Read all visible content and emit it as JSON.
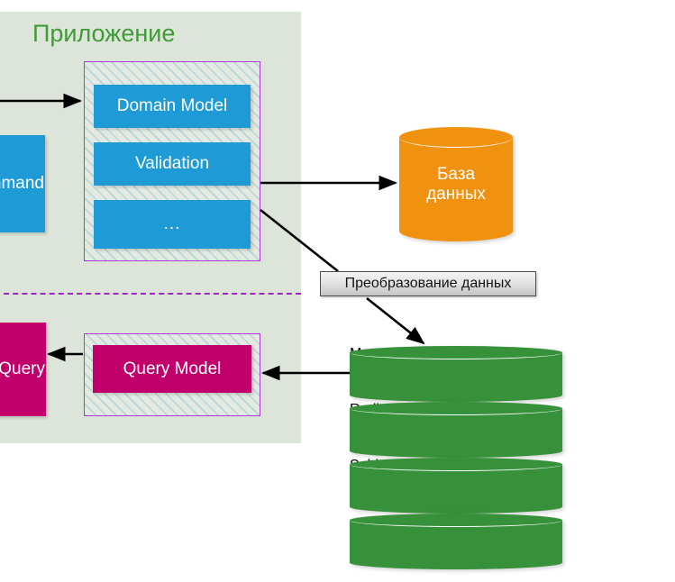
{
  "diagram": {
    "title": "Приложение",
    "title_color": "#3f9b35",
    "panel_color": "#dde5da"
  },
  "command_side": {
    "command_box_label": "Command",
    "container_items": [
      {
        "label": "Domain Model",
        "color": "#1e9bd7"
      },
      {
        "label": "Validation",
        "color": "#1e9bd7"
      },
      {
        "label": "...",
        "color": "#1e9bd7"
      }
    ]
  },
  "query_side": {
    "query_box_label": "Query",
    "query_model_label": "Query Model",
    "query_color": "#c2006c"
  },
  "write_store": {
    "label_line1": "База",
    "label_line2": "данных",
    "color": "#f0920f"
  },
  "read_stores": [
    {
      "label": "MongoDB",
      "color": "#36913a"
    },
    {
      "label": "Redis",
      "color": "#36913a"
    },
    {
      "label": "Sphinx",
      "color": "#36913a"
    },
    {
      "label": "...",
      "color": "#36913a"
    }
  ],
  "annotations": {
    "transform_label": "Преобразование данных"
  },
  "connectors": [
    {
      "name": "command-to-domain",
      "from": "command",
      "to": "domain-container"
    },
    {
      "name": "domain-to-database",
      "from": "domain-container",
      "to": "database"
    },
    {
      "name": "domain-to-mongodb",
      "from": "domain-container",
      "to": "mongodb"
    },
    {
      "name": "mongodb-to-query-model",
      "from": "mongodb",
      "to": "query-model"
    },
    {
      "name": "query-model-to-query",
      "from": "query-model",
      "to": "query"
    }
  ]
}
